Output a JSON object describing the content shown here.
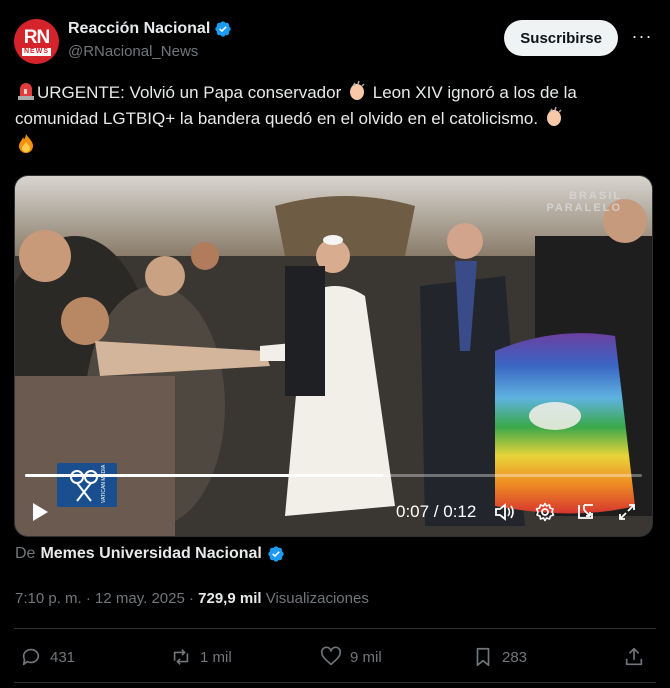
{
  "account": {
    "display_name": "Reacción Nacional",
    "handle": "@RNacional_News",
    "avatar_text": "RN",
    "avatar_subtext": "NEWS",
    "subscribe_label": "Suscribirse",
    "more_label": "···"
  },
  "tweet": {
    "text_line1": "URGENTE: Volvió un Papa conservador",
    "text_line1b": "Leon XIV ignoró a los de la",
    "text_line2": "comunidad LGTBIQ+ la bandera quedó en el olvido en el catolicismo.",
    "emojis": [
      "siren-emoji",
      "clapping-hands-emoji",
      "clapping-hands-emoji",
      "fire-emoji"
    ]
  },
  "video": {
    "watermark_line1": "BRASIL",
    "watermark_line2": "PARALELO",
    "time_display": "0:07 / 0:12",
    "progress_fraction": 0.58,
    "logo_text": "VATICAN MEDIA"
  },
  "source": {
    "prefix": "De",
    "name": "Memes Universidad Nacional"
  },
  "meta": {
    "timestamp": "7:10 p. m. · 12 may. 2025 ·",
    "views_count": "729,9 mil",
    "views_label": "Visualizaciones"
  },
  "actions": {
    "replies": "431",
    "reposts": "1 mil",
    "likes": "9 mil",
    "bookmarks": "283"
  },
  "colors": {
    "background": "#000000",
    "verified": "#1d9bf0",
    "muted": "#71767b",
    "text": "#e7e9ea",
    "avatar": "#d4232b"
  }
}
